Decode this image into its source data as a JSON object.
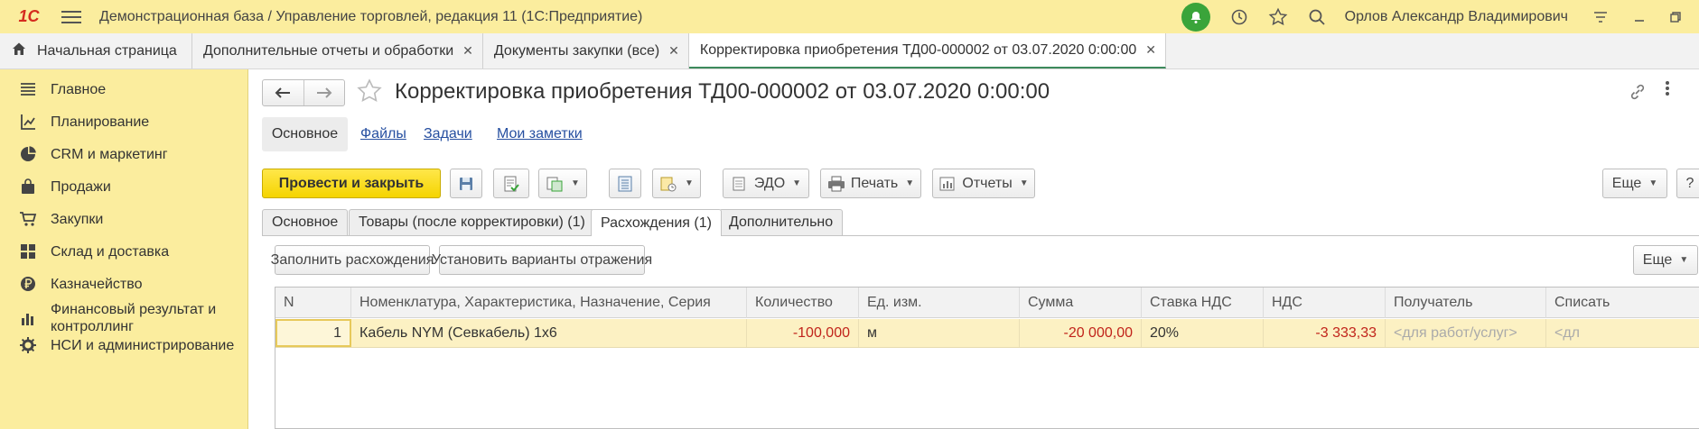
{
  "titlebar": {
    "logo": "1С",
    "app_title": "Демонстрационная база / Управление торговлей, редакция 11  (1С:Предприятие)",
    "user_name": "Орлов Александр Владимирович"
  },
  "tabs": {
    "home_label": "Начальная страница",
    "open": [
      {
        "label": "Дополнительные отчеты и обработки"
      },
      {
        "label": "Документы закупки (все)"
      },
      {
        "label": "Корректировка приобретения ТД00-000002 от 03.07.2020 0:00:00"
      }
    ],
    "close_glyph": "✕"
  },
  "sidebar": {
    "items": [
      {
        "label": "Главное",
        "icon": "menu-lines-icon"
      },
      {
        "label": "Планирование",
        "icon": "planning-icon"
      },
      {
        "label": "CRM и маркетинг",
        "icon": "pie-chart-icon"
      },
      {
        "label": "Продажи",
        "icon": "bag-icon"
      },
      {
        "label": "Закупки",
        "icon": "cart-icon"
      },
      {
        "label": "Склад и доставка",
        "icon": "warehouse-grid-icon"
      },
      {
        "label": "Казначейство",
        "icon": "ruble-coin-icon"
      },
      {
        "label": "Финансовый результат и контроллинг",
        "icon": "bar-chart-icon"
      },
      {
        "label": "НСИ и администрирование",
        "icon": "gear-icon"
      }
    ]
  },
  "document": {
    "title": "Корректировка приобретения ТД00-000002 от 03.07.2020 0:00:00",
    "sections": {
      "current": "Основное",
      "files": "Файлы",
      "tasks": "Задачи",
      "notes": "Мои заметки"
    }
  },
  "toolbar": {
    "post_close": "Провести и закрыть",
    "edo": "ЭДО",
    "print": "Печать",
    "reports": "Отчеты",
    "more": "Еще",
    "help": "?"
  },
  "page_tabs": {
    "main": "Основное",
    "goods": "Товары (после корректировки) (1)",
    "discrepancies": "Расхождения (1)",
    "additional": "Дополнительно"
  },
  "discrepancy_toolbar": {
    "fill": "Заполнить расхождения",
    "set_variants": "Установить варианты отражения",
    "more": "Еще"
  },
  "table": {
    "columns": {
      "n": "N",
      "item": "Номенклатура, Характеристика, Назначение, Серия",
      "qty": "Количество",
      "unit": "Ед. изм.",
      "sum": "Сумма",
      "vat_rate": "Ставка НДС",
      "vat": "НДС",
      "recipient": "Получатель",
      "writeoff": "Списать"
    },
    "rows": [
      {
        "n": "1",
        "item": "Кабель NYM (Севкабель) 1х6",
        "qty": "-100,000",
        "unit": "м",
        "sum": "-20 000,00",
        "vat_rate": "20%",
        "vat": "-3 333,33",
        "recipient": "<для работ/услуг>",
        "writeoff": "<дл"
      }
    ]
  },
  "colors": {
    "sidebar_bg": "#fbed9e",
    "primary_button": "#f5d400",
    "negative_value": "#c1241b",
    "active_tab_underline": "#3d8a5c"
  }
}
